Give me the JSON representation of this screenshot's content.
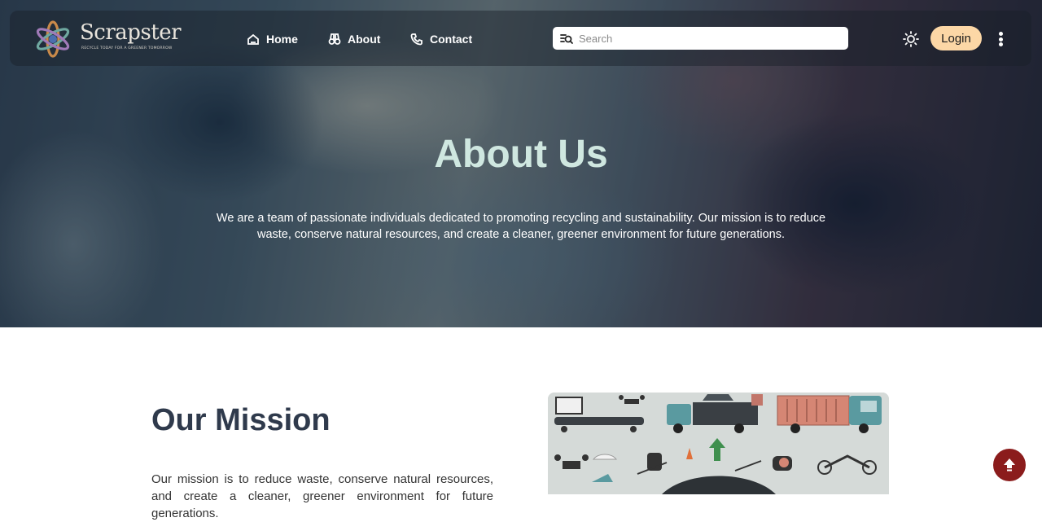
{
  "brand": {
    "name": "Scrapster",
    "tagline": "RECYCLE TODAY FOR A GREENER TOMORROW"
  },
  "nav": {
    "items": [
      {
        "label": "Home",
        "icon": "home-icon"
      },
      {
        "label": "About",
        "icon": "binoculars-icon"
      },
      {
        "label": "Contact",
        "icon": "phone-icon"
      }
    ]
  },
  "search": {
    "placeholder": "Search",
    "value": ""
  },
  "header": {
    "login_label": "Login"
  },
  "hero": {
    "title": "About Us",
    "description": "We are a team of passionate individuals dedicated to promoting recycling and sustainability. Our mission is to reduce waste, conserve natural resources, and create a cleaner, greener environment for future generations."
  },
  "mission": {
    "title": "Our Mission",
    "text": "Our mission is to reduce waste, conserve natural resources, and create a cleaner, greener environment for future generations."
  },
  "colors": {
    "login_bg": "#fcd7a6",
    "hero_title": "#cfe7e0",
    "scroll_top_bg": "#8b1c1c",
    "mission_title": "#2f3a4c"
  }
}
